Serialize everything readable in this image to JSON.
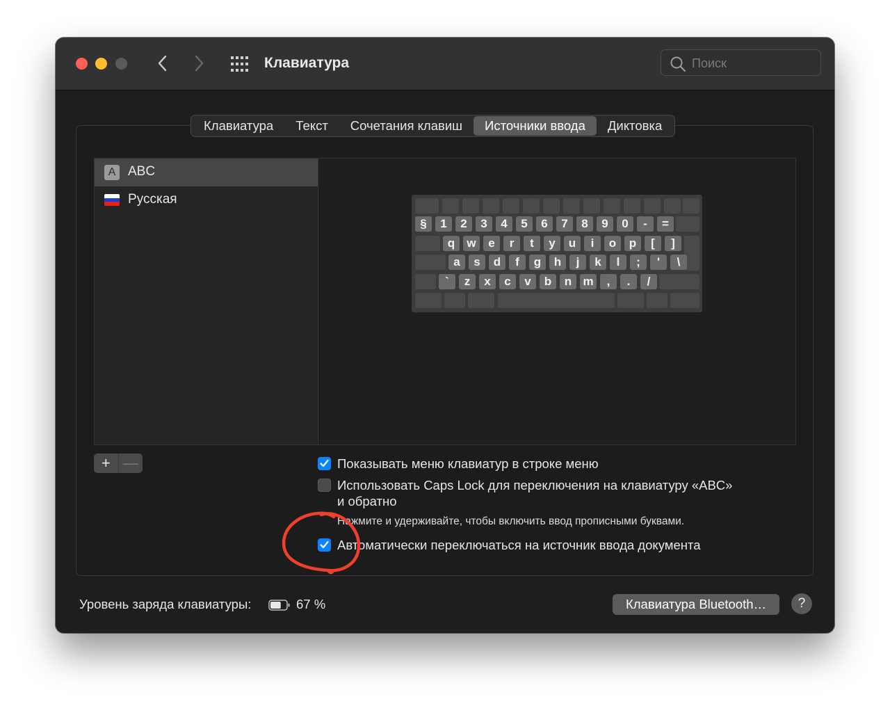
{
  "window": {
    "title": "Клавиатура"
  },
  "search": {
    "placeholder": "Поиск"
  },
  "tabs": [
    {
      "label": "Клавиатура",
      "active": false
    },
    {
      "label": "Текст",
      "active": false
    },
    {
      "label": "Сочетания клавиш",
      "active": false
    },
    {
      "label": "Источники ввода",
      "active": true
    },
    {
      "label": "Диктовка",
      "active": false
    }
  ],
  "sources": [
    {
      "label": "ABC",
      "icon": "abc-glyph",
      "selected": true
    },
    {
      "label": "Русская",
      "icon": "russia-flag-icon",
      "selected": false
    }
  ],
  "keyboard": {
    "rows": [
      [
        "§",
        "1",
        "2",
        "3",
        "4",
        "5",
        "6",
        "7",
        "8",
        "9",
        "0",
        "-",
        "="
      ],
      [
        "q",
        "w",
        "e",
        "r",
        "t",
        "y",
        "u",
        "i",
        "o",
        "p",
        "[",
        "]"
      ],
      [
        "a",
        "s",
        "d",
        "f",
        "g",
        "h",
        "j",
        "k",
        "l",
        ";",
        "'",
        "\\"
      ],
      [
        "`",
        "z",
        "x",
        "c",
        "v",
        "b",
        "n",
        "m",
        ",",
        ".",
        "/"
      ]
    ]
  },
  "controls": {
    "add": "+",
    "remove": "—"
  },
  "options": {
    "show_menu": {
      "label": "Показывать меню клавиатур в строке меню",
      "checked": true
    },
    "caps_lock": {
      "line1": "Использовать Caps Lock для переключения на клавиатуру «ABC»",
      "line2": "и обратно",
      "checked": false,
      "hint": "Нажмите и удерживайте, чтобы включить ввод прописными буквами."
    },
    "auto_switch": {
      "label": "Автоматически переключаться на источник ввода документа",
      "checked": true
    }
  },
  "footer": {
    "battery_label": "Уровень заряда клавиатуры:",
    "battery_value": "67 %",
    "battery_level": 0.67,
    "bluetooth_button": "Клавиатура Bluetooth…",
    "help": "?"
  },
  "colors": {
    "accent": "#0a84ff",
    "annotation": "#f0402a",
    "close": "#ff5f57",
    "minimize": "#febc2e"
  }
}
